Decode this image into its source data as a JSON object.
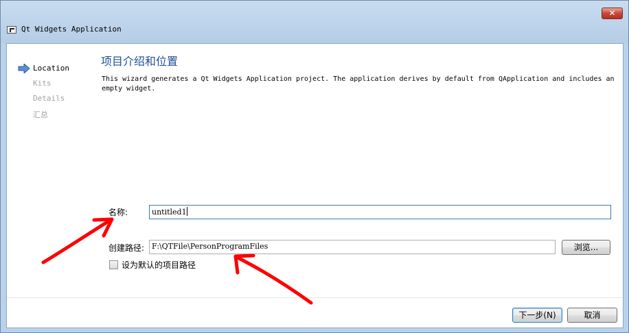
{
  "window": {
    "title": "Qt Widgets Application",
    "close_label": "✕"
  },
  "sidebar": {
    "items": [
      {
        "label": "Location",
        "active": true
      },
      {
        "label": "Kits",
        "active": false
      },
      {
        "label": "Details",
        "active": false
      },
      {
        "label": "汇总",
        "active": false
      }
    ]
  },
  "page": {
    "heading": "项目介绍和位置",
    "description": "This wizard generates a Qt Widgets Application project. The application derives by default from QApplication and includes an empty widget."
  },
  "form": {
    "name_label": "名称:",
    "name_value": "untitled1",
    "path_label": "创建路径:",
    "path_value": "F:\\QTFile\\PersonProgramFiles",
    "browse_label": "浏览...",
    "default_checkbox_label": "设为默认的项目路径",
    "default_checked": false
  },
  "footer": {
    "next_label": "下一步(N)",
    "cancel_label": "取消"
  },
  "colors": {
    "heading": "#1f4e99",
    "annotation_arrow": "#ff0000"
  }
}
